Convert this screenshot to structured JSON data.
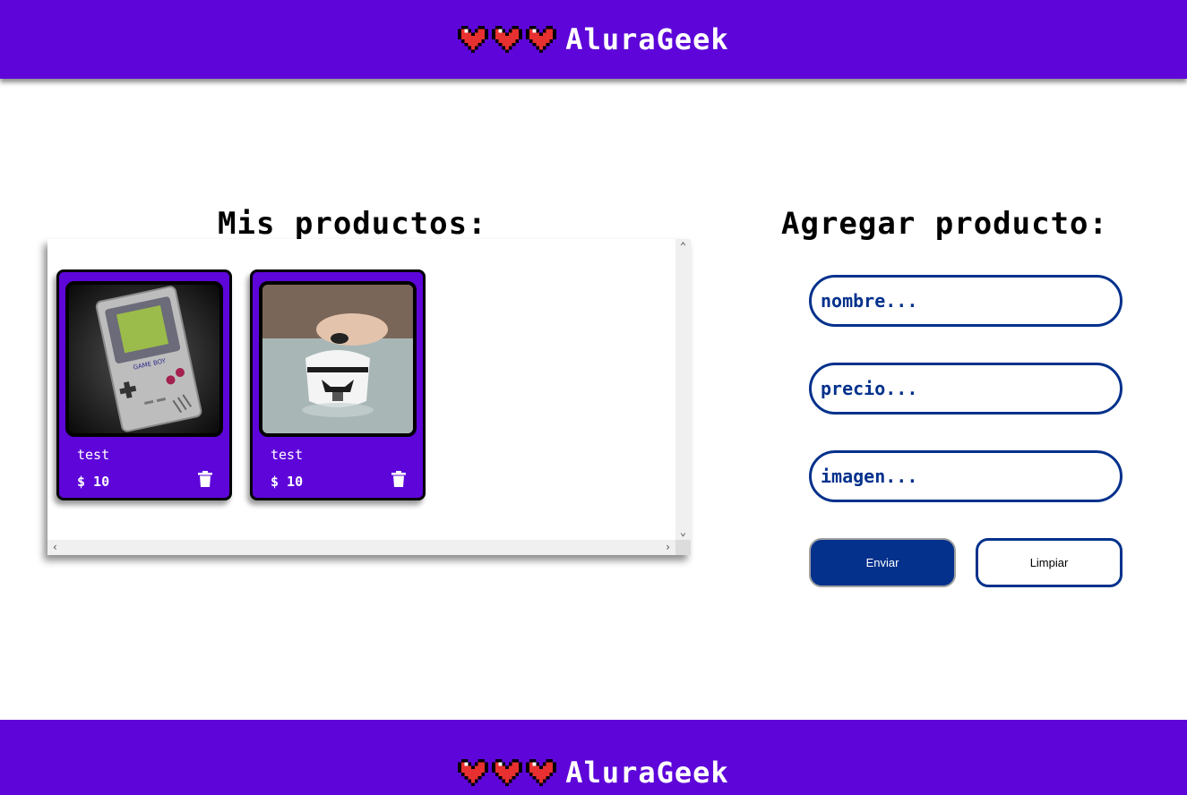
{
  "header": {
    "brand": "AluraGeek",
    "heart_color": "#e83030"
  },
  "footer": {
    "brand": "AluraGeek"
  },
  "products_section": {
    "title": "Mis productos:",
    "products": [
      {
        "name": "test",
        "price": "$ 10",
        "image": "game-boy-photo"
      },
      {
        "name": "test",
        "price": "$ 10",
        "image": "stormtrooper-mug-photo"
      }
    ]
  },
  "form": {
    "title": "Agregar producto:",
    "nombre_placeholder": "nombre...",
    "precio_placeholder": "precio...",
    "imagen_placeholder": "imagen...",
    "submit_label": "Enviar",
    "clear_label": "Limpiar"
  },
  "colors": {
    "primary": "#5e06d9",
    "accent": "#03318c"
  }
}
